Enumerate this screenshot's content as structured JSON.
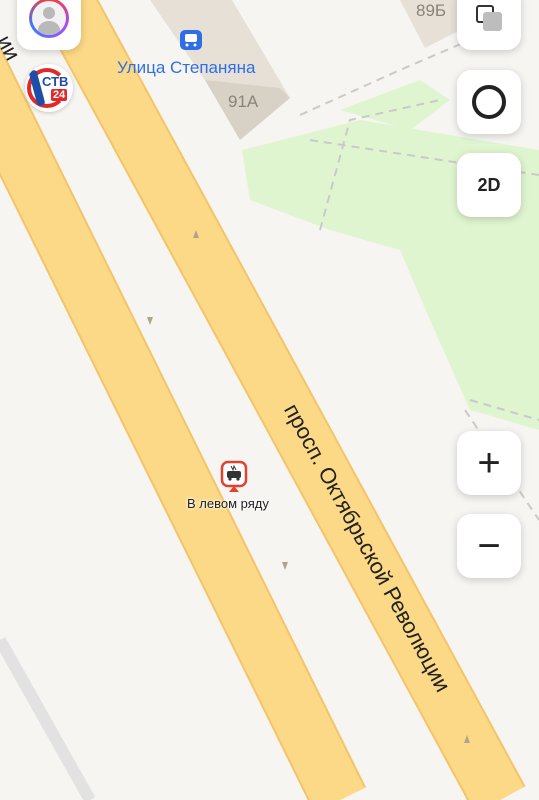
{
  "map": {
    "street_label": "просп. Октябрьской Революции",
    "street_label_partial": "ии",
    "transit_stop": {
      "name": "Улица Степаняна",
      "icon": "bus-stop-icon"
    },
    "buildings": [
      {
        "number": "91А"
      },
      {
        "number": "89Б"
      }
    ],
    "event_marker": {
      "label": "В левом ряду",
      "icon": "car-accident-icon",
      "color": "#e3412f"
    },
    "colors": {
      "road": "#fcd986",
      "road_edge": "#f3c46a",
      "park": "#dff5cf",
      "land": "#f6f5f1",
      "building": "#e6e0d7"
    }
  },
  "brand": {
    "logo_text": "СТВ",
    "logo_subtext": "24",
    "logo_icon": "stv24-logo"
  },
  "controls": {
    "profile": {
      "icon": "user-avatar-icon"
    },
    "layers": {
      "icon": "layers-icon"
    },
    "north": {
      "icon": "compass-icon"
    },
    "view_mode": {
      "label": "2D"
    },
    "zoom_in": {
      "label": "+"
    },
    "zoom_out": {
      "label": "−"
    }
  }
}
